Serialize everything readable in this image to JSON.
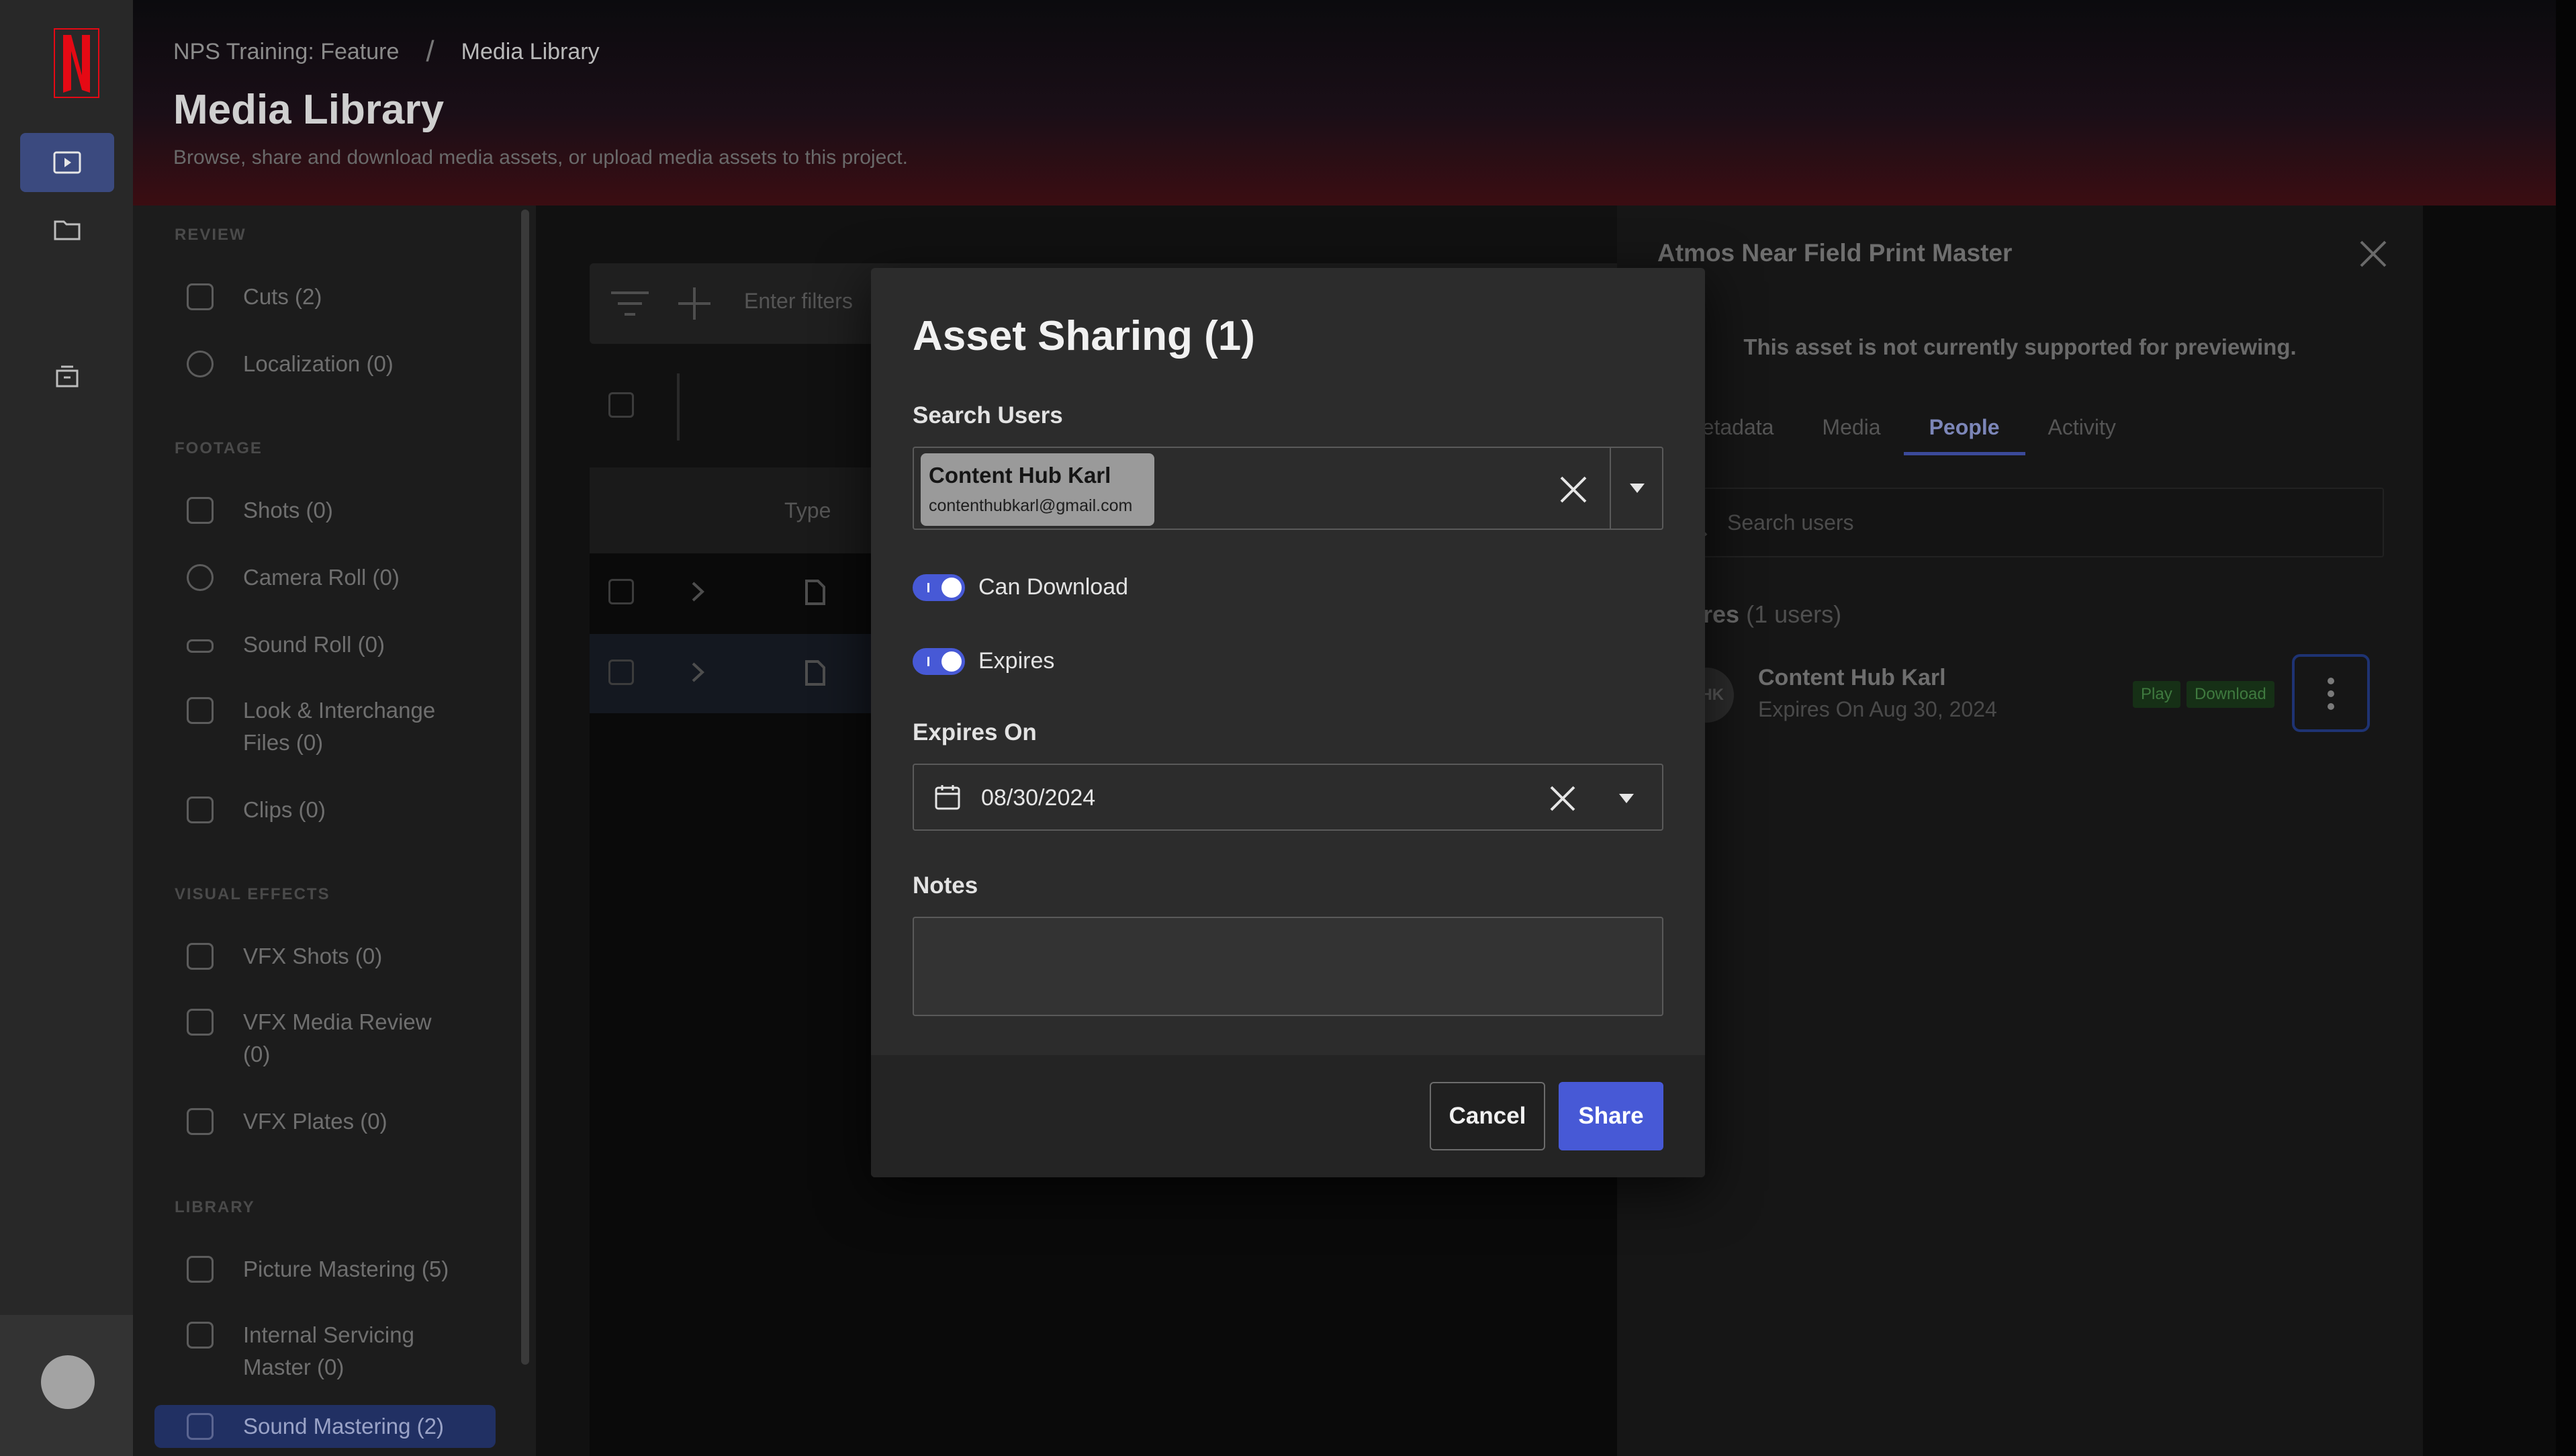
{
  "rail": {
    "logo_letter": "N",
    "items": [
      {
        "icon": "media-library-icon",
        "active": true
      },
      {
        "icon": "folder-icon",
        "active": false
      },
      {
        "icon": "archive-icon",
        "active": false
      }
    ]
  },
  "header": {
    "breadcrumb_parent": "NPS Training: Feature",
    "breadcrumb_sep": "/",
    "breadcrumb_current": "Media Library",
    "title": "Media Library",
    "subtitle": "Browse, share and download media assets, or upload media assets to this project."
  },
  "sidebar": {
    "sections": [
      {
        "label": "REVIEW",
        "items": [
          "Cuts (2)",
          "Localization (0)"
        ]
      },
      {
        "label": "FOOTAGE",
        "items": [
          "Shots (0)",
          "Camera Roll (0)",
          "Sound Roll (0)",
          "Look & Interchange Files (0)",
          "Clips (0)"
        ]
      },
      {
        "label": "VISUAL EFFECTS",
        "items": [
          "VFX Shots (0)",
          "VFX Media Review (0)",
          "VFX Plates (0)"
        ]
      },
      {
        "label": "LIBRARY",
        "items": [
          "Picture Mastering (5)",
          "Internal Servicing Master (0)",
          "Sound Mastering (2)"
        ]
      }
    ]
  },
  "content": {
    "filter_placeholder": "Enter filters",
    "column_type": "Type"
  },
  "drawer": {
    "title": "Atmos Near Field Print Master",
    "preview_note": "This asset is not currently supported for previewing.",
    "tabs": [
      "Metadata",
      "Media",
      "People",
      "Activity"
    ],
    "active_tab": "People",
    "search_placeholder": "Search users",
    "shares_label": "Shares",
    "shares_count": "(1 users)",
    "share": {
      "initials": "CHK",
      "name": "Content Hub Karl",
      "expires": "Expires On Aug 30, 2024",
      "badge_play": "Play",
      "badge_download": "Download"
    }
  },
  "modal": {
    "title": "Asset Sharing (1)",
    "search_label": "Search Users",
    "selected_user": {
      "name": "Content Hub Karl",
      "email": "contenthubkarl@gmail.com"
    },
    "can_download_label": "Can Download",
    "can_download_on": true,
    "expires_label": "Expires",
    "expires_on": true,
    "expires_on_label": "Expires On",
    "expires_date": "08/30/2024",
    "notes_label": "Notes",
    "notes_value": "",
    "cancel_label": "Cancel",
    "share_label": "Share",
    "accent": "#4759d6"
  }
}
